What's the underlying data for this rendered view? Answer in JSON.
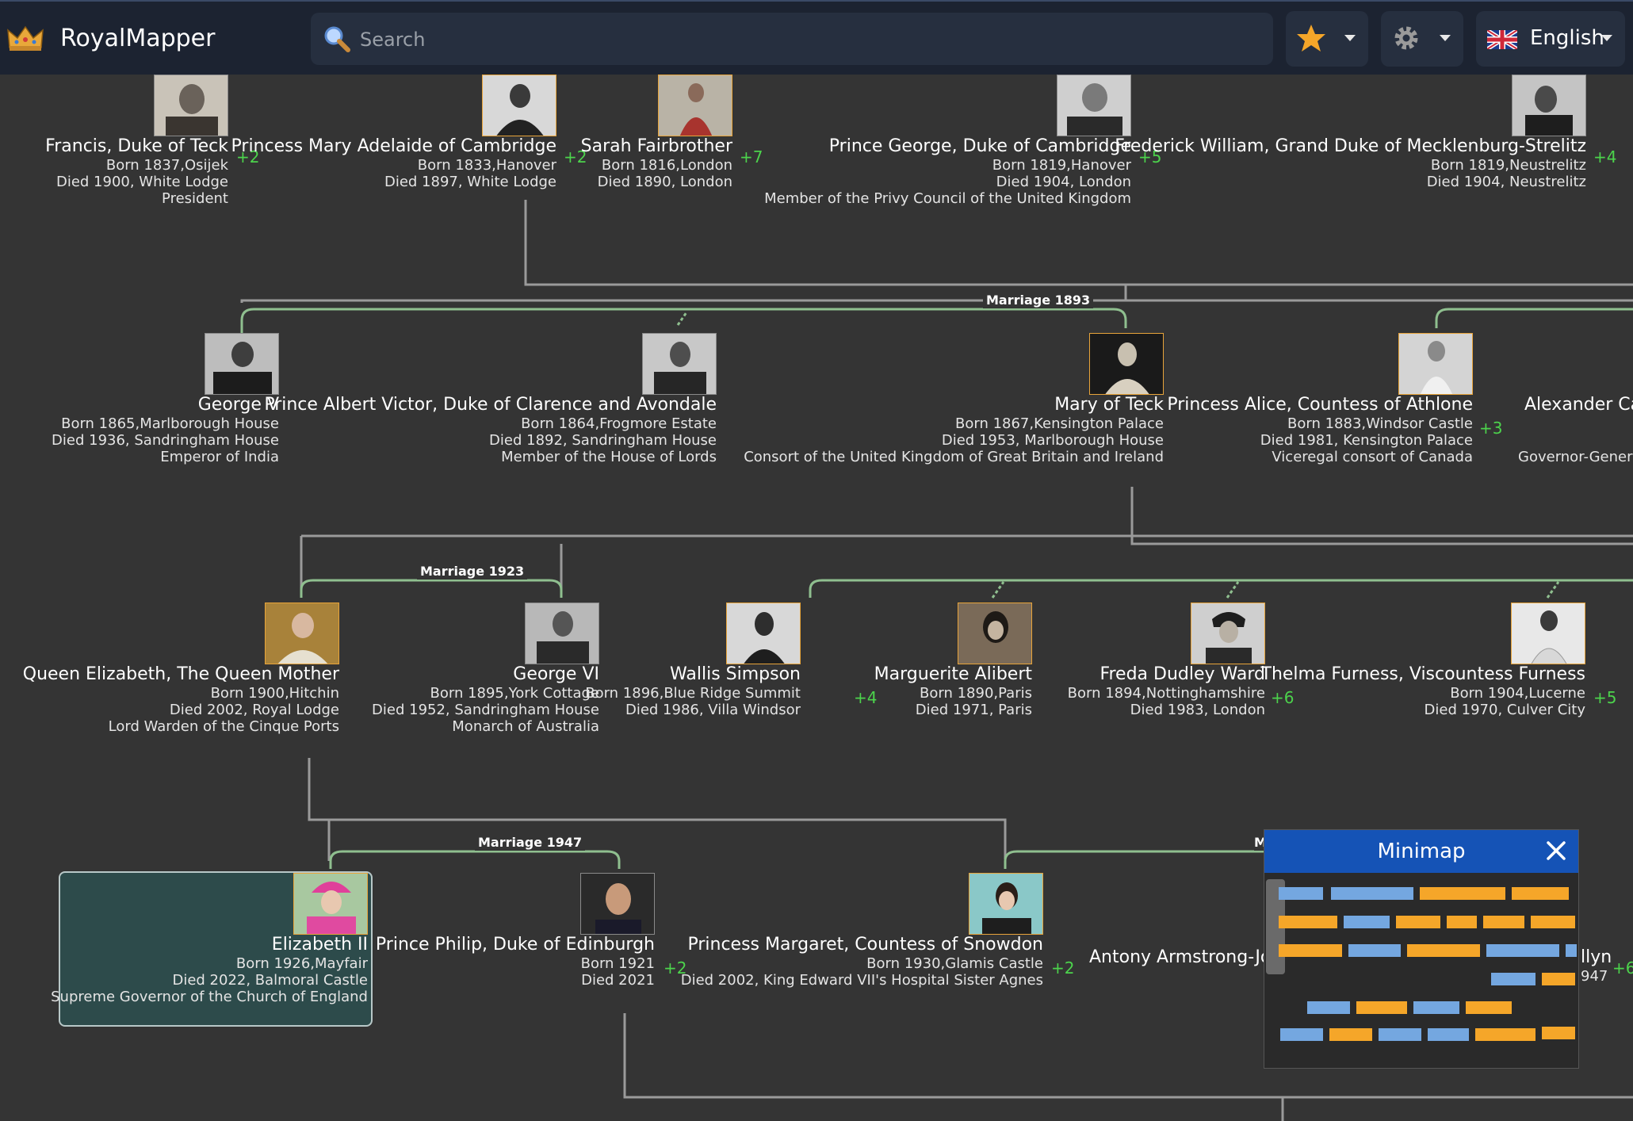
{
  "app": {
    "title": "RoyalMapper"
  },
  "search": {
    "placeholder": "Search"
  },
  "language": {
    "label": "English"
  },
  "colors": {
    "topbar": "#1c2331",
    "background": "#343434",
    "accent_green": "#4cd34c",
    "link_line": "#8fbf8f",
    "selected_bg": "#2d4b4b",
    "minimap_header": "#1553b6",
    "minimap_blue": "#74a7e0",
    "minimap_orange": "#f5a629"
  },
  "icons": {
    "logo": "crown-icon",
    "search": "search-icon",
    "favorites": "star-icon",
    "settings": "gear-icon",
    "language_flag": "uk-flag-icon",
    "dropdown": "chevron-down-icon",
    "close": "close-icon"
  },
  "row1": {
    "francis": {
      "name": "Francis, Duke of Teck",
      "born": "Born 1837,Osijek",
      "died": "Died 1900, White Lodge",
      "title": "President",
      "more": "+2"
    },
    "mary_adelaide": {
      "name": "Princess Mary Adelaide of Cambridge",
      "born": "Born 1833,Hanover",
      "died": "Died 1897, White Lodge",
      "more": "+2"
    },
    "sarah": {
      "name": "Sarah Fairbrother",
      "born": "Born 1816,London",
      "died": "Died 1890, London",
      "more": "+7"
    },
    "george_cambridge": {
      "name": "Prince George, Duke of Cambridge",
      "born": "Born 1819,Hanover",
      "died": "Died 1904, London",
      "title": "Member of the Privy Council of the United Kingdom",
      "more": "+5"
    },
    "frederick": {
      "name": "Frederick William, Grand Duke of Mecklenburg-Strelitz",
      "born": "Born 1819,Neustrelitz",
      "died": "Died 1904, Neustrelitz",
      "more": "+4"
    }
  },
  "row2": {
    "marriage_label": "Marriage 1893",
    "george_v": {
      "name": "George V",
      "born": "Born 1865,Marlborough House",
      "died": "Died 1936, Sandringham House",
      "title": "Emperor of India"
    },
    "albert_victor": {
      "name": "Prince Albert Victor, Duke of Clarence and Avondale",
      "born": "Born 1864,Frogmore Estate",
      "died": "Died 1892, Sandringham House",
      "title": "Member of the House of Lords"
    },
    "mary_teck": {
      "name": "Mary of Teck",
      "born": "Born 1867,Kensington Palace",
      "died": "Died 1953, Marlborough House",
      "title": "Consort of the United Kingdom of Great Britain and Ireland"
    },
    "alice": {
      "name": "Princess Alice, Countess of Athlone",
      "born": "Born 1883,Windsor Castle",
      "died": "Died 1981, Kensington Palace",
      "title": "Viceregal consort of Canada",
      "more": "+3"
    },
    "alexander": {
      "name": "Alexander Can",
      "title": "Governor-Genera"
    }
  },
  "row3": {
    "marriage_label": "Marriage 1923",
    "queen_mother": {
      "name": "Queen Elizabeth, The Queen Mother",
      "born": "Born 1900,Hitchin",
      "died": "Died 2002, Royal Lodge",
      "title": "Lord Warden of the Cinque Ports"
    },
    "george_vi": {
      "name": "George VI",
      "born": "Born 1895,York Cottage",
      "died": "Died 1952, Sandringham House",
      "title": "Monarch of Australia"
    },
    "wallis": {
      "name": "Wallis Simpson",
      "born": "Born 1896,Blue Ridge Summit",
      "died": "Died 1986, Villa Windsor",
      "more": "+4"
    },
    "marguerite": {
      "name": "Marguerite Alibert",
      "born": "Born 1890,Paris",
      "died": "Died 1971, Paris"
    },
    "freda": {
      "name": "Freda Dudley Ward",
      "born": "Born 1894,Nottinghamshire",
      "died": "Died 1983, London",
      "more": "+6"
    },
    "thelma": {
      "name": "Thelma Furness, Viscountess Furness",
      "born": "Born 1904,Lucerne",
      "died": "Died 1970, Culver City",
      "more": "+5"
    }
  },
  "row4": {
    "marriage_label": "Marriage 1947",
    "marriage_label_partial": "M",
    "elizabeth": {
      "name": "Elizabeth II",
      "born": "Born 1926,Mayfair",
      "died": "Died 2022, Balmoral Castle",
      "title": "Supreme Governor of the Church of England"
    },
    "philip": {
      "name": "Prince Philip, Duke of Edinburgh",
      "born": "Born 1921",
      "died": "Died 2021",
      "more": "+2"
    },
    "margaret": {
      "name": "Princess Margaret, Countess of Snowdon",
      "born": "Born 1930,Glamis Castle",
      "died": "Died 2002, King Edward VII's Hospital Sister Agnes",
      "more": "+2"
    },
    "antony": {
      "name": "Antony Armstrong-Jone"
    },
    "partial": {
      "name": "llyn",
      "born": "947",
      "more": "+6"
    }
  },
  "minimap": {
    "title": "Minimap"
  }
}
